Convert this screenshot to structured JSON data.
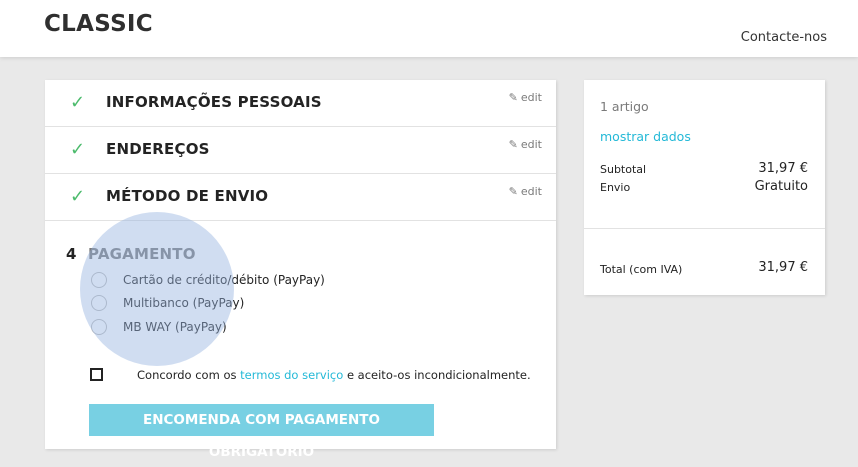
{
  "header": {
    "brand": "CLASSIC",
    "contact_label": "Contacte-nos"
  },
  "steps": [
    {
      "title": "INFORMAÇÕES PESSOAIS",
      "edit_label": "edit",
      "completed": true
    },
    {
      "title": "ENDEREÇOS",
      "edit_label": "edit",
      "completed": true
    },
    {
      "title": "MÉTODO DE ENVIO",
      "edit_label": "edit",
      "completed": true
    }
  ],
  "payment": {
    "number": "4",
    "title": "PAGAMENTO",
    "options": [
      {
        "label": "Cartão de crédito/débito (PayPay)"
      },
      {
        "label": "Multibanco (PayPay)"
      },
      {
        "label": "MB WAY (PayPay)"
      }
    ],
    "terms_prefix": "Concordo com os",
    "terms_link": "termos do serviço",
    "terms_suffix": "e aceito-os incondicionalmente.",
    "terms_checked": false,
    "order_button": "ENCOMENDA COM PAGAMENTO OBRIGATÓRIO"
  },
  "summary": {
    "item_count": "1 artigo",
    "show_details": "mostrar dados",
    "subtotal_label": "Subtotal",
    "subtotal_value": "31,97 €",
    "shipping_label": "Envio",
    "shipping_value": "Gratuito",
    "total_label": "Total (com IVA)",
    "total_value": "31,97 €"
  },
  "colors": {
    "accent": "#24b9d7",
    "button": "#78d0e3",
    "check": "#4cbb6c",
    "background": "#e9e9e9"
  },
  "icons": {
    "check": "check-icon",
    "edit": "pencil-icon",
    "radio": "radio-icon",
    "checkbox": "checkbox-icon"
  }
}
